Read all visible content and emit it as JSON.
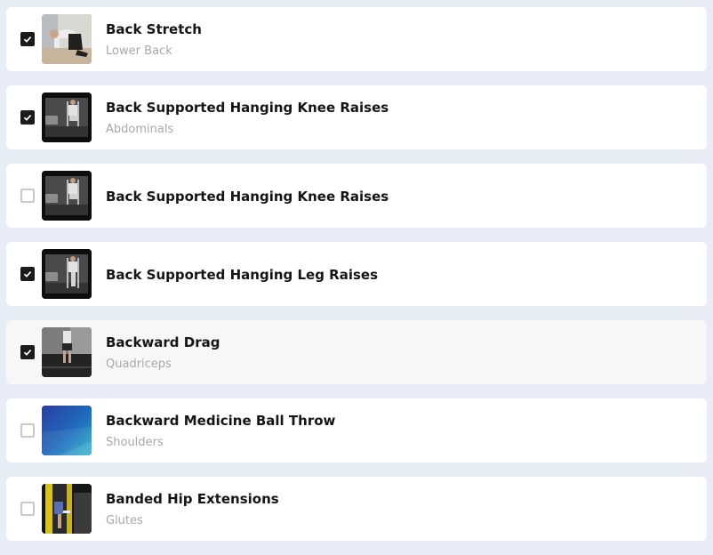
{
  "exercises": [
    {
      "name": "Back Stretch",
      "muscle": "Lower Back",
      "checked": true
    },
    {
      "name": "Back Supported Hanging Knee Raises",
      "muscle": "Abdominals",
      "checked": true
    },
    {
      "name": "Back Supported Hanging Knee Raises",
      "muscle": "",
      "checked": false
    },
    {
      "name": "Back Supported Hanging Leg Raises",
      "muscle": "",
      "checked": true
    },
    {
      "name": "Backward Drag",
      "muscle": "Quadriceps",
      "checked": true
    },
    {
      "name": "Backward Medicine Ball Throw",
      "muscle": "Shoulders",
      "checked": false
    },
    {
      "name": "Banded Hip Extensions",
      "muscle": "Glutes",
      "checked": false
    }
  ],
  "thumbnail_icons": [
    "back-stretch-thumbnail",
    "hanging-knee-raise-thumbnail",
    "hanging-knee-raise-thumbnail",
    "hanging-leg-raise-thumbnail",
    "backward-drag-thumbnail",
    "medicine-ball-throw-thumbnail",
    "banded-hip-extension-thumbnail"
  ],
  "colors": {
    "background": "#e8ecf6",
    "card": "#ffffff",
    "card_highlight": "#f7f7f7",
    "checkbox_checked": "#1b1b1b",
    "title_text": "#151515",
    "subtitle_text": "#a8a8a8"
  }
}
